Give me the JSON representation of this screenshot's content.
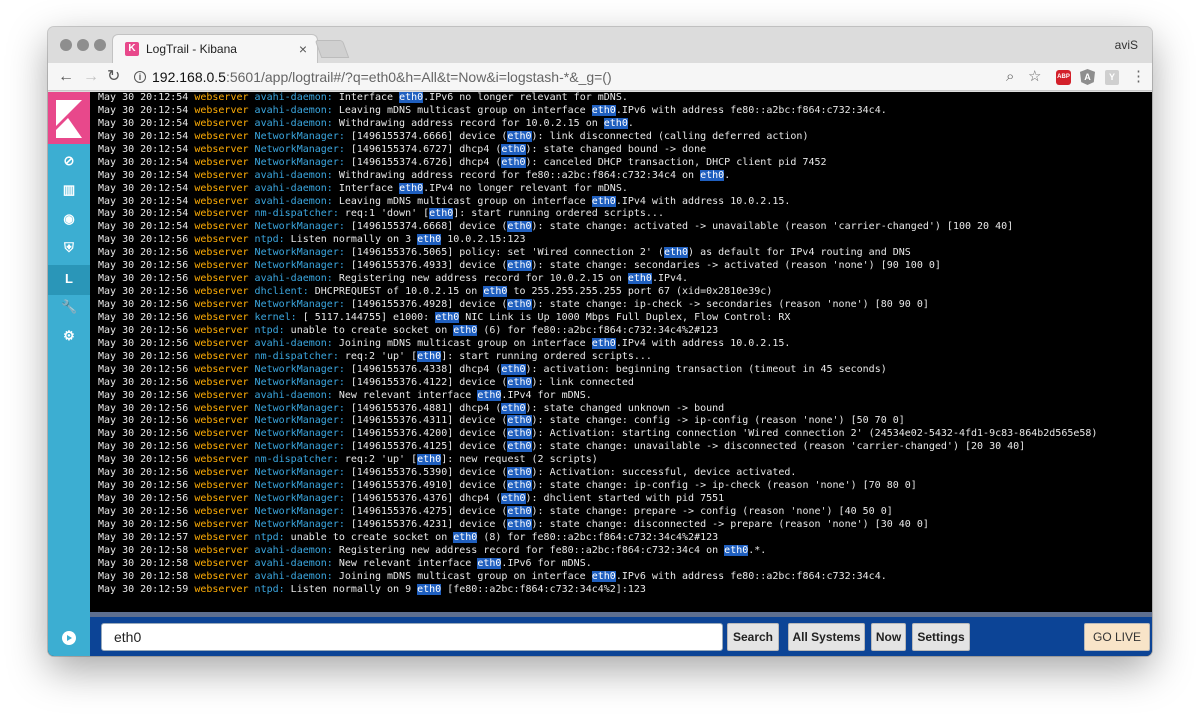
{
  "browser": {
    "tab_title": "LogTrail - Kibana",
    "tab_close": "×",
    "favicon_letter": "K",
    "profile_name": "aviS",
    "url_host": "192.168.0.5",
    "url_rest": ":5601/app/logtrail#/?q=eth0&h=All&t=Now&i=logstash-*&_g=()",
    "back": "←",
    "forward": "→",
    "reload": "↻",
    "info": "i",
    "zoom_icon": "⌕",
    "star_icon": "☆",
    "abp_label": "ABP",
    "ext_a_label": "A",
    "ext_y_label": "Y",
    "menu_icon": "⋮"
  },
  "sidebar": {
    "items": [
      {
        "name": "discover",
        "glyph": "⊘"
      },
      {
        "name": "visualize",
        "glyph": "▥"
      },
      {
        "name": "dashboard",
        "glyph": "◉"
      },
      {
        "name": "timelion",
        "glyph": "⛨"
      },
      {
        "name": "logtrail",
        "glyph": "L"
      },
      {
        "name": "devtools",
        "glyph": "🔧"
      },
      {
        "name": "management",
        "glyph": "⚙"
      }
    ]
  },
  "logs": [
    [
      {
        "t": "May 30 20:12:54 ",
        "c": "ts"
      },
      {
        "t": "webserver",
        "c": "host"
      },
      {
        "t": " "
      },
      {
        "t": "avahi-daemon:",
        "c": "prog"
      },
      {
        "t": " Interface "
      },
      {
        "t": "eth0",
        "c": "hl"
      },
      {
        "t": ".IPv6 no longer relevant for mDNS."
      }
    ],
    [
      {
        "t": "May 30 20:12:54 ",
        "c": "ts"
      },
      {
        "t": "webserver",
        "c": "host"
      },
      {
        "t": " "
      },
      {
        "t": "avahi-daemon:",
        "c": "prog"
      },
      {
        "t": " Leaving mDNS multicast group on interface "
      },
      {
        "t": "eth0",
        "c": "hl"
      },
      {
        "t": ".IPv6 with address fe80::a2bc:f864:c732:34c4."
      }
    ],
    [
      {
        "t": "May 30 20:12:54 ",
        "c": "ts"
      },
      {
        "t": "webserver",
        "c": "host"
      },
      {
        "t": " "
      },
      {
        "t": "avahi-daemon:",
        "c": "prog"
      },
      {
        "t": " Withdrawing address record for 10.0.2.15 on "
      },
      {
        "t": "eth0",
        "c": "hl"
      },
      {
        "t": "."
      }
    ],
    [
      {
        "t": "May 30 20:12:54 ",
        "c": "ts"
      },
      {
        "t": "webserver",
        "c": "host"
      },
      {
        "t": " "
      },
      {
        "t": "NetworkManager:",
        "c": "prog"
      },
      {
        "t": " [1496155374.6666] device ("
      },
      {
        "t": "eth0",
        "c": "hl"
      },
      {
        "t": "): link disconnected (calling deferred action)"
      }
    ],
    [
      {
        "t": "May 30 20:12:54 ",
        "c": "ts"
      },
      {
        "t": "webserver",
        "c": "host"
      },
      {
        "t": " "
      },
      {
        "t": "NetworkManager:",
        "c": "prog"
      },
      {
        "t": " [1496155374.6727] dhcp4 ("
      },
      {
        "t": "eth0",
        "c": "hl"
      },
      {
        "t": "): state changed bound -> done"
      }
    ],
    [
      {
        "t": "May 30 20:12:54 ",
        "c": "ts"
      },
      {
        "t": "webserver",
        "c": "host"
      },
      {
        "t": " "
      },
      {
        "t": "NetworkManager:",
        "c": "prog"
      },
      {
        "t": " [1496155374.6726] dhcp4 ("
      },
      {
        "t": "eth0",
        "c": "hl"
      },
      {
        "t": "): canceled DHCP transaction, DHCP client pid 7452"
      }
    ],
    [
      {
        "t": "May 30 20:12:54 ",
        "c": "ts"
      },
      {
        "t": "webserver",
        "c": "host"
      },
      {
        "t": " "
      },
      {
        "t": "avahi-daemon:",
        "c": "prog"
      },
      {
        "t": " Withdrawing address record for fe80::a2bc:f864:c732:34c4 on "
      },
      {
        "t": "eth0",
        "c": "hl"
      },
      {
        "t": "."
      }
    ],
    [
      {
        "t": "May 30 20:12:54 ",
        "c": "ts"
      },
      {
        "t": "webserver",
        "c": "host"
      },
      {
        "t": " "
      },
      {
        "t": "avahi-daemon:",
        "c": "prog"
      },
      {
        "t": " Interface "
      },
      {
        "t": "eth0",
        "c": "hl"
      },
      {
        "t": ".IPv4 no longer relevant for mDNS."
      }
    ],
    [
      {
        "t": "May 30 20:12:54 ",
        "c": "ts"
      },
      {
        "t": "webserver",
        "c": "host"
      },
      {
        "t": " "
      },
      {
        "t": "avahi-daemon:",
        "c": "prog"
      },
      {
        "t": " Leaving mDNS multicast group on interface "
      },
      {
        "t": "eth0",
        "c": "hl"
      },
      {
        "t": ".IPv4 with address 10.0.2.15."
      }
    ],
    [
      {
        "t": "May 30 20:12:54 ",
        "c": "ts"
      },
      {
        "t": "webserver",
        "c": "host"
      },
      {
        "t": " "
      },
      {
        "t": "nm-dispatcher:",
        "c": "prog"
      },
      {
        "t": " req:1 'down' ["
      },
      {
        "t": "eth0",
        "c": "hl"
      },
      {
        "t": "]: start running ordered scripts..."
      }
    ],
    [
      {
        "t": "May 30 20:12:54 ",
        "c": "ts"
      },
      {
        "t": "webserver",
        "c": "host"
      },
      {
        "t": " "
      },
      {
        "t": "NetworkManager:",
        "c": "prog"
      },
      {
        "t": " [1496155374.6668] device ("
      },
      {
        "t": "eth0",
        "c": "hl"
      },
      {
        "t": "): state change: activated -> unavailable (reason 'carrier-changed') [100 20 40]"
      }
    ],
    [
      {
        "t": "May 30 20:12:56 ",
        "c": "ts"
      },
      {
        "t": "webserver",
        "c": "host"
      },
      {
        "t": " "
      },
      {
        "t": "ntpd:",
        "c": "prog"
      },
      {
        "t": " Listen normally on 3 "
      },
      {
        "t": "eth0",
        "c": "hl"
      },
      {
        "t": " 10.0.2.15:123"
      }
    ],
    [
      {
        "t": "May 30 20:12:56 ",
        "c": "ts"
      },
      {
        "t": "webserver",
        "c": "host"
      },
      {
        "t": " "
      },
      {
        "t": "NetworkManager:",
        "c": "prog"
      },
      {
        "t": " [1496155376.5065] policy: set 'Wired connection 2' ("
      },
      {
        "t": "eth0",
        "c": "hl"
      },
      {
        "t": ") as default for IPv4 routing and DNS"
      }
    ],
    [
      {
        "t": "May 30 20:12:56 ",
        "c": "ts"
      },
      {
        "t": "webserver",
        "c": "host"
      },
      {
        "t": " "
      },
      {
        "t": "NetworkManager:",
        "c": "prog"
      },
      {
        "t": " [1496155376.4933] device ("
      },
      {
        "t": "eth0",
        "c": "hl"
      },
      {
        "t": "): state change: secondaries -> activated (reason 'none') [90 100 0]"
      }
    ],
    [
      {
        "t": "May 30 20:12:56 ",
        "c": "ts"
      },
      {
        "t": "webserver",
        "c": "host"
      },
      {
        "t": " "
      },
      {
        "t": "avahi-daemon:",
        "c": "prog"
      },
      {
        "t": " Registering new address record for 10.0.2.15 on "
      },
      {
        "t": "eth0",
        "c": "hl"
      },
      {
        "t": ".IPv4."
      }
    ],
    [
      {
        "t": "May 30 20:12:56 ",
        "c": "ts"
      },
      {
        "t": "webserver",
        "c": "host"
      },
      {
        "t": " "
      },
      {
        "t": "dhclient:",
        "c": "prog"
      },
      {
        "t": " DHCPREQUEST of 10.0.2.15 on "
      },
      {
        "t": "eth0",
        "c": "hl"
      },
      {
        "t": " to 255.255.255.255 port 67 (xid=0x2810e39c)"
      }
    ],
    [
      {
        "t": "May 30 20:12:56 ",
        "c": "ts"
      },
      {
        "t": "webserver",
        "c": "host"
      },
      {
        "t": " "
      },
      {
        "t": "NetworkManager:",
        "c": "prog"
      },
      {
        "t": " [1496155376.4928] device ("
      },
      {
        "t": "eth0",
        "c": "hl"
      },
      {
        "t": "): state change: ip-check -> secondaries (reason 'none') [80 90 0]"
      }
    ],
    [
      {
        "t": "May 30 20:12:56 ",
        "c": "ts"
      },
      {
        "t": "webserver",
        "c": "host"
      },
      {
        "t": " "
      },
      {
        "t": "kernel:",
        "c": "prog"
      },
      {
        "t": " [ 5117.144755] e1000: "
      },
      {
        "t": "eth0",
        "c": "hl"
      },
      {
        "t": " NIC Link is Up 1000 Mbps Full Duplex, Flow Control: RX"
      }
    ],
    [
      {
        "t": "May 30 20:12:56 ",
        "c": "ts"
      },
      {
        "t": "webserver",
        "c": "host"
      },
      {
        "t": " "
      },
      {
        "t": "ntpd:",
        "c": "prog"
      },
      {
        "t": " unable to create socket on "
      },
      {
        "t": "eth0",
        "c": "hl"
      },
      {
        "t": " (6) for fe80::a2bc:f864:c732:34c4%2#123"
      }
    ],
    [
      {
        "t": "May 30 20:12:56 ",
        "c": "ts"
      },
      {
        "t": "webserver",
        "c": "host"
      },
      {
        "t": " "
      },
      {
        "t": "avahi-daemon:",
        "c": "prog"
      },
      {
        "t": " Joining mDNS multicast group on interface "
      },
      {
        "t": "eth0",
        "c": "hl"
      },
      {
        "t": ".IPv4 with address 10.0.2.15."
      }
    ],
    [
      {
        "t": "May 30 20:12:56 ",
        "c": "ts"
      },
      {
        "t": "webserver",
        "c": "host"
      },
      {
        "t": " "
      },
      {
        "t": "nm-dispatcher:",
        "c": "prog"
      },
      {
        "t": " req:2 'up' ["
      },
      {
        "t": "eth0",
        "c": "hl"
      },
      {
        "t": "]: start running ordered scripts..."
      }
    ],
    [
      {
        "t": "May 30 20:12:56 ",
        "c": "ts"
      },
      {
        "t": "webserver",
        "c": "host"
      },
      {
        "t": " "
      },
      {
        "t": "NetworkManager:",
        "c": "prog"
      },
      {
        "t": " [1496155376.4338] dhcp4 ("
      },
      {
        "t": "eth0",
        "c": "hl"
      },
      {
        "t": "): activation: beginning transaction (timeout in 45 seconds)"
      }
    ],
    [
      {
        "t": "May 30 20:12:56 ",
        "c": "ts"
      },
      {
        "t": "webserver",
        "c": "host"
      },
      {
        "t": " "
      },
      {
        "t": "NetworkManager:",
        "c": "prog"
      },
      {
        "t": " [1496155376.4122] device ("
      },
      {
        "t": "eth0",
        "c": "hl"
      },
      {
        "t": "): link connected"
      }
    ],
    [
      {
        "t": "May 30 20:12:56 ",
        "c": "ts"
      },
      {
        "t": "webserver",
        "c": "host"
      },
      {
        "t": " "
      },
      {
        "t": "avahi-daemon:",
        "c": "prog"
      },
      {
        "t": " New relevant interface "
      },
      {
        "t": "eth0",
        "c": "hl"
      },
      {
        "t": ".IPv4 for mDNS."
      }
    ],
    [
      {
        "t": "May 30 20:12:56 ",
        "c": "ts"
      },
      {
        "t": "webserver",
        "c": "host"
      },
      {
        "t": " "
      },
      {
        "t": "NetworkManager:",
        "c": "prog"
      },
      {
        "t": " [1496155376.4881] dhcp4 ("
      },
      {
        "t": "eth0",
        "c": "hl"
      },
      {
        "t": "): state changed unknown -> bound"
      }
    ],
    [
      {
        "t": "May 30 20:12:56 ",
        "c": "ts"
      },
      {
        "t": "webserver",
        "c": "host"
      },
      {
        "t": " "
      },
      {
        "t": "NetworkManager:",
        "c": "prog"
      },
      {
        "t": " [1496155376.4311] device ("
      },
      {
        "t": "eth0",
        "c": "hl"
      },
      {
        "t": "): state change: config -> ip-config (reason 'none') [50 70 0]"
      }
    ],
    [
      {
        "t": "May 30 20:12:56 ",
        "c": "ts"
      },
      {
        "t": "webserver",
        "c": "host"
      },
      {
        "t": " "
      },
      {
        "t": "NetworkManager:",
        "c": "prog"
      },
      {
        "t": " [1496155376.4200] device ("
      },
      {
        "t": "eth0",
        "c": "hl"
      },
      {
        "t": "): Activation: starting connection 'Wired connection 2' (24534e02-5432-4fd1-9c83-864b2d565e58)"
      }
    ],
    [
      {
        "t": "May 30 20:12:56 ",
        "c": "ts"
      },
      {
        "t": "webserver",
        "c": "host"
      },
      {
        "t": " "
      },
      {
        "t": "NetworkManager:",
        "c": "prog"
      },
      {
        "t": " [1496155376.4125] device ("
      },
      {
        "t": "eth0",
        "c": "hl"
      },
      {
        "t": "): state change: unavailable -> disconnected (reason 'carrier-changed') [20 30 40]"
      }
    ],
    [
      {
        "t": "May 30 20:12:56 ",
        "c": "ts"
      },
      {
        "t": "webserver",
        "c": "host"
      },
      {
        "t": " "
      },
      {
        "t": "nm-dispatcher:",
        "c": "prog"
      },
      {
        "t": " req:2 'up' ["
      },
      {
        "t": "eth0",
        "c": "hl"
      },
      {
        "t": "]: new request (2 scripts)"
      }
    ],
    [
      {
        "t": "May 30 20:12:56 ",
        "c": "ts"
      },
      {
        "t": "webserver",
        "c": "host"
      },
      {
        "t": " "
      },
      {
        "t": "NetworkManager:",
        "c": "prog"
      },
      {
        "t": " [1496155376.5390] device ("
      },
      {
        "t": "eth0",
        "c": "hl"
      },
      {
        "t": "): Activation: successful, device activated."
      }
    ],
    [
      {
        "t": "May 30 20:12:56 ",
        "c": "ts"
      },
      {
        "t": "webserver",
        "c": "host"
      },
      {
        "t": " "
      },
      {
        "t": "NetworkManager:",
        "c": "prog"
      },
      {
        "t": " [1496155376.4910] device ("
      },
      {
        "t": "eth0",
        "c": "hl"
      },
      {
        "t": "): state change: ip-config -> ip-check (reason 'none') [70 80 0]"
      }
    ],
    [
      {
        "t": "May 30 20:12:56 ",
        "c": "ts"
      },
      {
        "t": "webserver",
        "c": "host"
      },
      {
        "t": " "
      },
      {
        "t": "NetworkManager:",
        "c": "prog"
      },
      {
        "t": " [1496155376.4376] dhcp4 ("
      },
      {
        "t": "eth0",
        "c": "hl"
      },
      {
        "t": "): dhclient started with pid 7551"
      }
    ],
    [
      {
        "t": "May 30 20:12:56 ",
        "c": "ts"
      },
      {
        "t": "webserver",
        "c": "host"
      },
      {
        "t": " "
      },
      {
        "t": "NetworkManager:",
        "c": "prog"
      },
      {
        "t": " [1496155376.4275] device ("
      },
      {
        "t": "eth0",
        "c": "hl"
      },
      {
        "t": "): state change: prepare -> config (reason 'none') [40 50 0]"
      }
    ],
    [
      {
        "t": "May 30 20:12:56 ",
        "c": "ts"
      },
      {
        "t": "webserver",
        "c": "host"
      },
      {
        "t": " "
      },
      {
        "t": "NetworkManager:",
        "c": "prog"
      },
      {
        "t": " [1496155376.4231] device ("
      },
      {
        "t": "eth0",
        "c": "hl"
      },
      {
        "t": "): state change: disconnected -> prepare (reason 'none') [30 40 0]"
      }
    ],
    [
      {
        "t": "May 30 20:12:57 ",
        "c": "ts"
      },
      {
        "t": "webserver",
        "c": "host"
      },
      {
        "t": " "
      },
      {
        "t": "ntpd:",
        "c": "prog"
      },
      {
        "t": " unable to create socket on "
      },
      {
        "t": "eth0",
        "c": "hl"
      },
      {
        "t": " (8) for fe80::a2bc:f864:c732:34c4%2#123"
      }
    ],
    [
      {
        "t": "May 30 20:12:58 ",
        "c": "ts"
      },
      {
        "t": "webserver",
        "c": "host"
      },
      {
        "t": " "
      },
      {
        "t": "avahi-daemon:",
        "c": "prog"
      },
      {
        "t": " Registering new address record for fe80::a2bc:f864:c732:34c4 on "
      },
      {
        "t": "eth0",
        "c": "hl"
      },
      {
        "t": ".*."
      }
    ],
    [
      {
        "t": "May 30 20:12:58 ",
        "c": "ts"
      },
      {
        "t": "webserver",
        "c": "host"
      },
      {
        "t": " "
      },
      {
        "t": "avahi-daemon:",
        "c": "prog"
      },
      {
        "t": " New relevant interface "
      },
      {
        "t": "eth0",
        "c": "hl"
      },
      {
        "t": ".IPv6 for mDNS."
      }
    ],
    [
      {
        "t": "May 30 20:12:58 ",
        "c": "ts"
      },
      {
        "t": "webserver",
        "c": "host"
      },
      {
        "t": " "
      },
      {
        "t": "avahi-daemon:",
        "c": "prog"
      },
      {
        "t": " Joining mDNS multicast group on interface "
      },
      {
        "t": "eth0",
        "c": "hl"
      },
      {
        "t": ".IPv6 with address fe80::a2bc:f864:c732:34c4."
      }
    ],
    [
      {
        "t": "May 30 20:12:59 ",
        "c": "ts"
      },
      {
        "t": "webserver",
        "c": "host"
      },
      {
        "t": " "
      },
      {
        "t": "ntpd:",
        "c": "prog"
      },
      {
        "t": " Listen normally on 9 "
      },
      {
        "t": "eth0",
        "c": "hl"
      },
      {
        "t": " [fe80::a2bc:f864:c732:34c4%2]:123"
      }
    ]
  ],
  "bottombar": {
    "search_value": "eth0",
    "search_button": "Search",
    "systems_button": "All Systems",
    "time_button": "Now",
    "settings_button": "Settings",
    "golive_button": "GO LIVE"
  },
  "colors": {
    "kibana_pink": "#e8488b",
    "sidebar_blue": "#3caed2",
    "bottombar_blue": "#0c4496",
    "hostname_orange": "#ffad05",
    "program_blue": "#3ba7e0",
    "highlight_blue": "#1f5fbf"
  }
}
